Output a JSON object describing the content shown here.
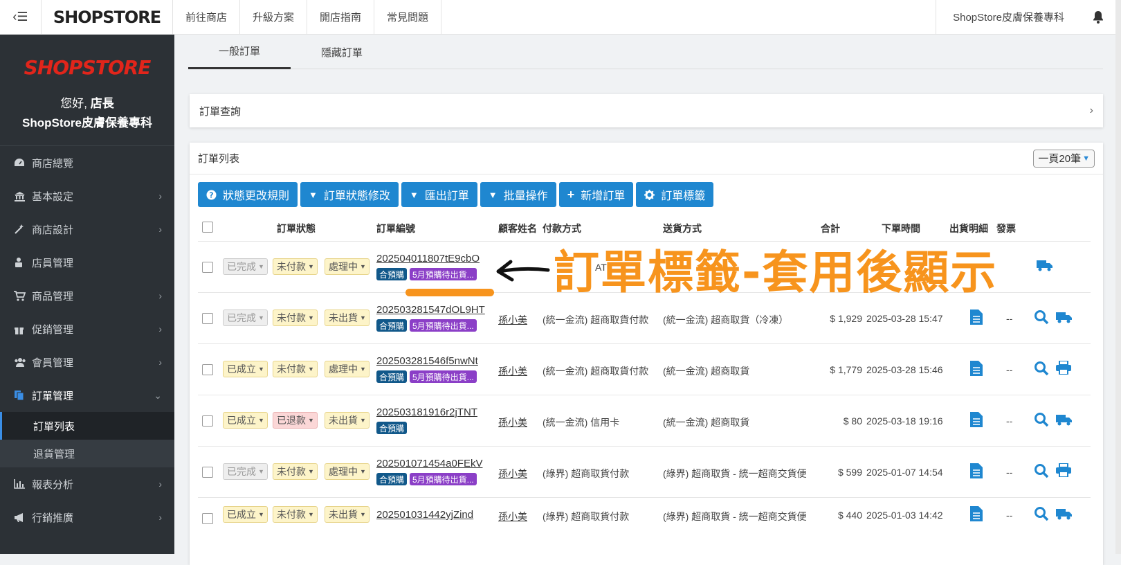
{
  "topbar": {
    "logo": "SHOPSTORE",
    "links": [
      "前往商店",
      "升級方案",
      "開店指南",
      "常見問題"
    ],
    "shop_name": "ShopStore皮膚保養專科"
  },
  "sidebar": {
    "logo": "SHOPSTORE",
    "greeting_prefix": "您好,",
    "greeting_role": "店長",
    "store_name": "ShopStore皮膚保養專科",
    "items": [
      {
        "label": "商店總覽",
        "icon": "dashboard-icon"
      },
      {
        "label": "基本設定",
        "icon": "bank-icon"
      },
      {
        "label": "商店設計",
        "icon": "magic-wand-icon"
      },
      {
        "label": "店員管理",
        "icon": "user-lock-icon"
      },
      {
        "label": "商品管理",
        "icon": "cart-icon"
      },
      {
        "label": "促銷管理",
        "icon": "gift-icon"
      },
      {
        "label": "會員管理",
        "icon": "users-icon"
      },
      {
        "label": "訂單管理",
        "icon": "copy-icon"
      }
    ],
    "sub_items": [
      "訂單列表",
      "退貨管理"
    ],
    "items_after": [
      {
        "label": "報表分析",
        "icon": "bar-chart-icon"
      },
      {
        "label": "行銷推廣",
        "icon": "bullhorn-icon"
      }
    ]
  },
  "tabs": [
    "一般訂單",
    "隱藏訂單"
  ],
  "query": {
    "title": "訂單查詢"
  },
  "list": {
    "title": "訂單列表",
    "per_page": "一頁20筆",
    "buttons": [
      "狀態更改規則",
      "訂單狀態修改",
      "匯出訂單",
      "批量操作",
      "新增訂單",
      "訂單標籤"
    ],
    "headers": {
      "status": "訂單狀態",
      "order_no": "訂單編號",
      "customer": "顧客姓名",
      "payment": "付款方式",
      "shipping": "送貨方式",
      "total": "合計",
      "date": "下單時間",
      "detail": "出貨明細",
      "invoice": "發票"
    },
    "rows": [
      {
        "s1": "已完成",
        "s2": "未付款",
        "s3": "處理中",
        "no": "202504011807tE9cbO",
        "tags": [
          "合預購",
          "5月預購待出貨..."
        ],
        "cust": "",
        "pay": "AT",
        "ship": "",
        "total": "",
        "date": "",
        "inv": "",
        "act": "truck"
      },
      {
        "s1": "已完成",
        "s2": "未付款",
        "s3": "未出貨",
        "no": "202503281547dOL9HT",
        "tags": [
          "合預購",
          "5月預購待出貨..."
        ],
        "cust": "孫小美",
        "pay": "(統一金流) 超商取貨付款",
        "ship": "(統一金流) 超商取貨（冷凍）",
        "total": "$ 1,929",
        "date": "2025-03-28 15:47",
        "inv": "--",
        "act": "truck"
      },
      {
        "s1": "已成立",
        "s2": "未付款",
        "s3": "處理中",
        "no": "202503281546f5nwNt",
        "tags": [
          "合預購",
          "5月預購待出貨..."
        ],
        "cust": "孫小美",
        "pay": "(統一金流) 超商取貨付款",
        "ship": "(統一金流) 超商取貨",
        "total": "$ 1,779",
        "date": "2025-03-28 15:46",
        "inv": "--",
        "act": "print"
      },
      {
        "s1": "已成立",
        "s2": "已退款",
        "s3": "未出貨",
        "no": "202503181916r2jTNT",
        "tags": [
          "合預購"
        ],
        "cust": "孫小美",
        "pay": "(統一金流) 信用卡",
        "ship": "(統一金流) 超商取貨",
        "total": "$ 80",
        "date": "2025-03-18 19:16",
        "inv": "--",
        "act": "truck"
      },
      {
        "s1": "已完成",
        "s2": "未付款",
        "s3": "處理中",
        "no": "202501071454a0FEkV",
        "tags": [
          "合預購",
          "5月預購待出貨..."
        ],
        "cust": "孫小美",
        "pay": "(綠界) 超商取貨付款",
        "ship": "(綠界) 超商取貨 - 統一超商交貨便",
        "total": "$ 599",
        "date": "2025-01-07 14:54",
        "inv": "--",
        "act": "print"
      },
      {
        "s1": "已成立",
        "s2": "未付款",
        "s3": "未出貨",
        "no": "202501031442yjZind",
        "tags": [],
        "cust": "孫小美",
        "pay": "(綠界) 超商取貨付款",
        "ship": "(綠界) 超商取貨 - 統一超商交貨便",
        "total": "$ 440",
        "date": "2025-01-03 14:42",
        "inv": "--",
        "act": "truck"
      }
    ]
  },
  "annotation": "訂單標籤-套用後顯示",
  "colors": {
    "accent": "#1f87d0",
    "sidebar": "#2c3136",
    "annotation": "#f7941d",
    "tag_blue": "#11588a",
    "tag_purple": "#8b3fc7",
    "logo_red": "#e1251b"
  }
}
